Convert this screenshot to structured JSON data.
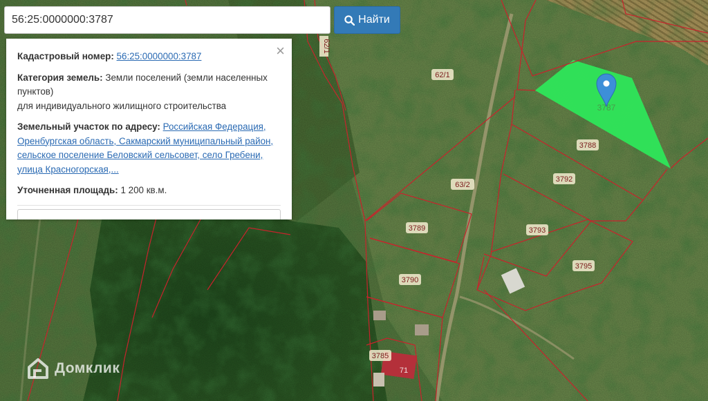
{
  "search": {
    "value": "56:25:0000000:3787",
    "button_label": "Найти"
  },
  "info": {
    "cadastral_label": "Кадастровый номер:",
    "cadastral_value": "56:25:0000000:3787",
    "category_label": "Категория земель:",
    "category_value": "Земли поселений (земли населенных пунктов)",
    "category_use": "для индивидуального жилищного строительства",
    "address_label": "Земельный участок по адресу:",
    "address_value": "Российская Федерация, Оренбургская область, Сакмарский муниципальный район, сельское поселение Беловский сельсовет, село Гребени, улица Красногорская,...",
    "area_label": "Уточненная площадь:",
    "area_value": "1 200 кв.м.",
    "close_symbol": "×"
  },
  "map": {
    "parcel_labels": [
      "62/1",
      "62/1",
      "3787",
      "3788",
      "3792",
      "63/2",
      "3789",
      "3793",
      "3795",
      "3790",
      "3785",
      "71"
    ],
    "colors": {
      "selected_parcel": "#2ee65a",
      "boundary": "#c8232c",
      "marker": "#3d8fd8"
    }
  },
  "logo": {
    "text": "Домклик"
  },
  "icons": {
    "search_button": "search-icon",
    "marker": "map-marker-icon",
    "close": "close-icon",
    "logo": "domclick-house-icon"
  }
}
